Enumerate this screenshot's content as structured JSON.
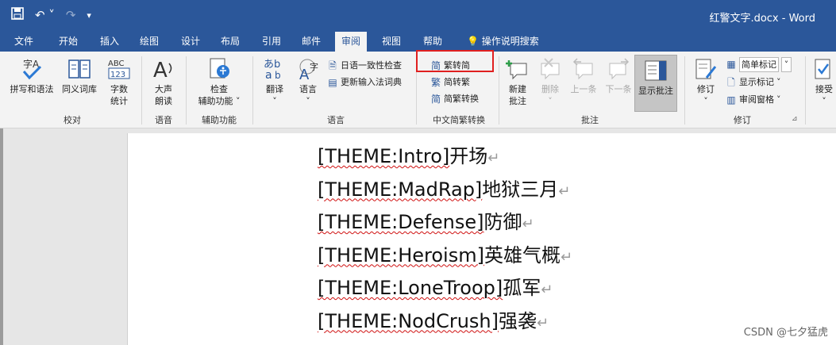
{
  "window": {
    "title": "红警文字.docx - Word",
    "qat": {
      "save_icon": "save-icon",
      "undo_icon": "undo-icon",
      "redo_icon": "redo-icon",
      "customize_icon": "chevron-down-icon"
    }
  },
  "tabs": [
    "文件",
    "开始",
    "插入",
    "绘图",
    "设计",
    "布局",
    "引用",
    "邮件",
    "审阅",
    "视图",
    "帮助",
    "操作说明搜索"
  ],
  "active_tab": "审阅",
  "ribbon": {
    "proofing": {
      "spelling": "拼写和语法",
      "thesaurus": "同义词库",
      "wordcount_line1": "字数",
      "wordcount_line2": "统计",
      "label": "校对"
    },
    "speech": {
      "readaloud_line1": "大声",
      "readaloud_line2": "朗读",
      "label": "语音"
    },
    "accessibility": {
      "check_line1": "检查",
      "check_line2": "辅助功能",
      "label": "辅助功能"
    },
    "language": {
      "translate": "翻译",
      "language": "语言",
      "japanese": "日语一致性检查",
      "update_ime": "更新输入法词典",
      "label": "语言"
    },
    "chinese": {
      "to_simplified": "繁转简",
      "to_traditional": "简转繁",
      "convert": "简繁转换",
      "label": "中文简繁转换"
    },
    "comments": {
      "new_line1": "新建",
      "new_line2": "批注",
      "delete": "删除",
      "prev": "上一条",
      "next": "下一条",
      "show": "显示批注",
      "label": "批注"
    },
    "tracking": {
      "track": "修订",
      "markup": "简单标记",
      "show_markup": "显示标记",
      "pane": "审阅窗格",
      "label": "修订"
    },
    "changes": {
      "accept": "接受"
    }
  },
  "document": {
    "lines": [
      {
        "en": "[THEME:Intro]",
        "zh": "开场"
      },
      {
        "en": "[THEME:MadRap]",
        "zh": "地狱三月"
      },
      {
        "en": "[THEME:Defense]",
        "zh": "防御"
      },
      {
        "en": "[THEME:Heroism]",
        "zh": "英雄气概"
      },
      {
        "en": "[THEME:LoneTroop]",
        "zh": "孤军"
      },
      {
        "en": "[THEME:NodCrush]",
        "zh": "强袭"
      }
    ],
    "para_mark": "↵"
  },
  "watermark": "CSDN @七夕猛虎",
  "colors": {
    "accent": "#2b579a",
    "highlight": "#e02020"
  }
}
